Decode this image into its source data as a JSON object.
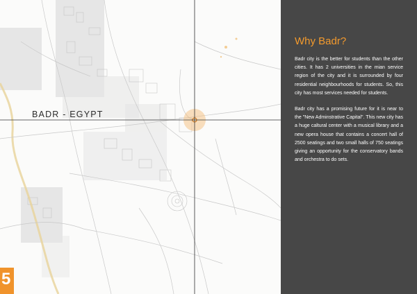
{
  "map": {
    "location_label": "BADR - EGYPT",
    "highlight_color": "#f5b971",
    "crosshair_color": "#333333"
  },
  "page": {
    "number": "5",
    "accent_color": "#f0932b"
  },
  "panel": {
    "title": "Why Badr?",
    "paragraphs": [
      "Badr city is the better for students than the other cities. It has 2 universities in the mian service region of the city and it is surrounded by four residential neighbourhoods for students. So, this city has most services needed for students.",
      "Badr city has a promising future for it is near to the \"New Adminstrative Capital\". This new city has a huge caltural center with a musical library and a new opera house that contains a concert hall of 2500 seatings and two small halls of 750 seatings giving an opportunity for the conservatory bands and orchestra to do sets."
    ],
    "background_color": "#474747",
    "title_color": "#f39a2d"
  }
}
